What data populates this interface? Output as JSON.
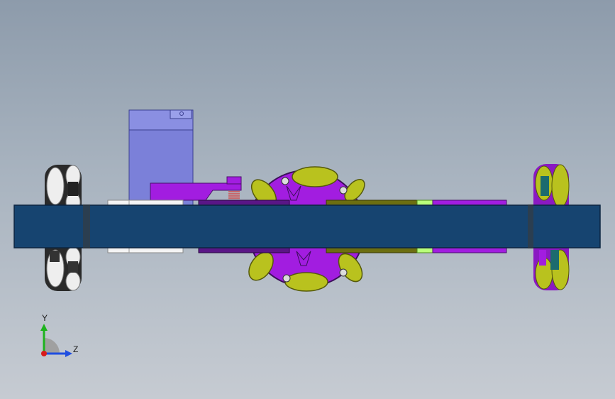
{
  "viewport": {
    "background_top": "#8d9bab",
    "background_bottom": "#c6cbd2"
  },
  "model": {
    "colors": {
      "frame": "#164470",
      "servo": "#7b80d9",
      "purple_parts": "#a21de0",
      "dark_purple": "#5a1686",
      "olive_rollers": "#b9c21e",
      "wheel_white": "#eeeeee",
      "wheel_dark": "#2a2a2a",
      "teal": "#1c6b6e"
    }
  },
  "triad": {
    "y_label": "Y",
    "z_label": "Z",
    "y_color": "#1db31d",
    "z_color": "#1f4ee0",
    "x_color": "#d81b1b"
  }
}
